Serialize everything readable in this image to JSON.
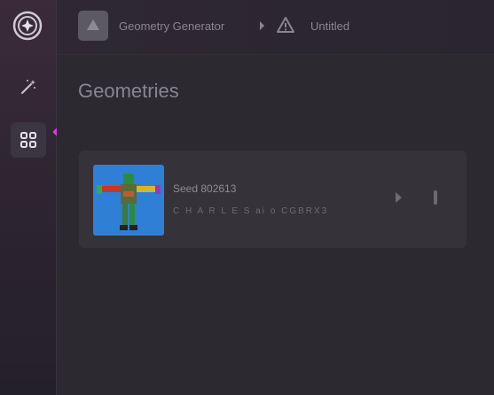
{
  "header": {
    "breadcrumb_app": "Geometry Generator",
    "breadcrumb_doc": "Untitled"
  },
  "main": {
    "title": "Geometries",
    "items": [
      {
        "title": "Seed 802613",
        "meta": "C H A R L E S   ai o CGBRX3"
      }
    ]
  },
  "icons": {
    "logo": "sparkle-logo-icon",
    "wand": "magic-wand-icon",
    "grid": "grid-icon",
    "app_thumb": "cube-icon",
    "separator": "chevron-right-icon",
    "warning": "warning-icon",
    "open": "chevron-right-icon",
    "more": "more-vertical-icon",
    "annotation": "arrow-icon"
  },
  "colors": {
    "annotation_arrow": "#d63be0",
    "thumbnail_bg": "#2f7fd6"
  }
}
